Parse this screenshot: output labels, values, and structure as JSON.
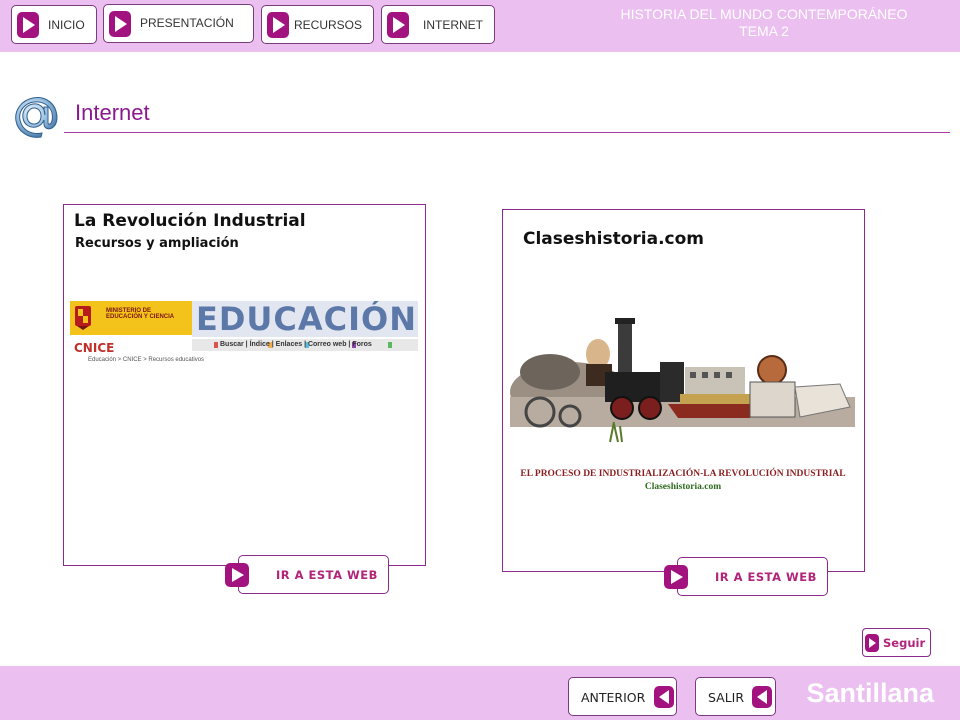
{
  "nav": {
    "buttons": [
      {
        "label": "INICIO"
      },
      {
        "label": "PRESENTACIÓN"
      },
      {
        "label": "RECURSOS"
      },
      {
        "label": "INTERNET"
      }
    ],
    "header_line1": "HISTORIA DEL MUNDO CONTEMPORÁNEO",
    "header_line2": "TEMA 2"
  },
  "section": {
    "title": "Internet",
    "icon": "at-sign-icon"
  },
  "cards": [
    {
      "title": "La Revolución Industrial",
      "subtitle": "Recursos y ampliación",
      "banner": {
        "ministry": "MINISTERIO DE EDUCACIÓN Y CIENCIA",
        "big": "EDUCACIÓN",
        "cnice": "CNICE",
        "links": "Buscar | Índice | Enlaces | Correo web | Foros",
        "crumb": "Educación > CNICE > Recursos educativos"
      },
      "button_label": "IR A ESTA WEB"
    },
    {
      "title": "Claseshistoria.com",
      "caption1": "EL PROCESO DE INDUSTRIALIZACIÓN-LA REVOLUCIÓN INDUSTRIAL",
      "caption2": "Claseshistoria.com",
      "button_label": "IR A ESTA WEB"
    }
  ],
  "seguir_label": "Seguir",
  "footer": {
    "prev_label": "ANTERIOR",
    "exit_label": "SALIR",
    "brand": "Santillana"
  },
  "colors": {
    "bar": "#ebbff0",
    "accent": "#8b1a8e",
    "play": "#a3137f"
  }
}
